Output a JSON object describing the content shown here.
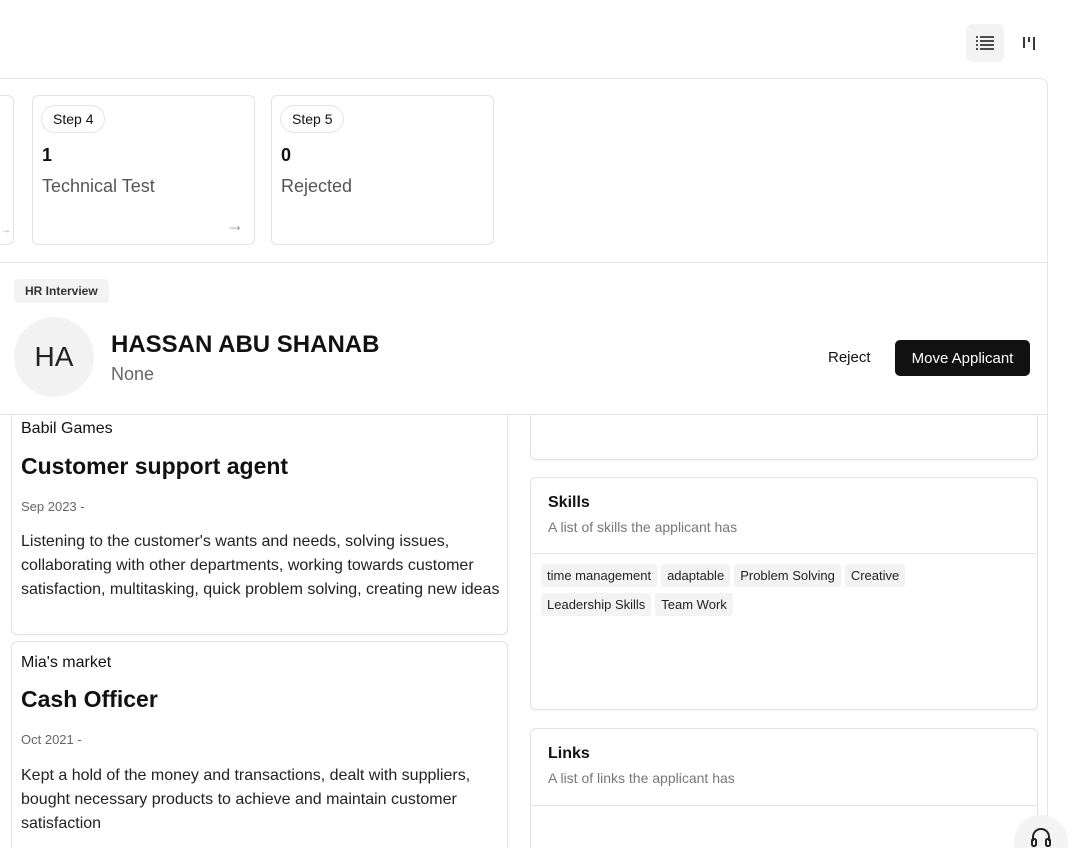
{
  "toolbar": {
    "list_view_icon": "list-icon",
    "board_view_icon": "kanban-icon"
  },
  "steps": [
    {
      "badge": "Step 4",
      "count": "1",
      "label": "Technical Test"
    },
    {
      "badge": "Step 5",
      "count": "0",
      "label": "Rejected"
    }
  ],
  "applicant": {
    "stage": "HR Interview",
    "initials": "HA",
    "name": "HASSAN ABU SHANAB",
    "subtitle": "None",
    "reject_label": "Reject",
    "move_label": "Move Applicant"
  },
  "experience": [
    {
      "company": "Babil Games",
      "role": "Customer support agent",
      "date": "Sep 2023 -",
      "description": "Listening to the customer's wants and needs, solving issues, collaborating with other departments, working towards customer satisfaction, multitasking, quick problem solving, creating new ideas"
    },
    {
      "company": "Mia's market",
      "role": "Cash Officer",
      "date": "Oct 2021 -",
      "description": "Kept a hold of the money and transactions, dealt with suppliers, bought necessary products to achieve and maintain customer satisfaction"
    }
  ],
  "skills": {
    "title": "Skills",
    "subtitle": "A list of skills the applicant has",
    "items": [
      "time management",
      "adaptable",
      "Problem Solving",
      "Creative",
      "Leadership Skills",
      "Team Work"
    ]
  },
  "links": {
    "title": "Links",
    "subtitle": "A list of links the applicant has"
  },
  "support_icon": "headset-icon"
}
